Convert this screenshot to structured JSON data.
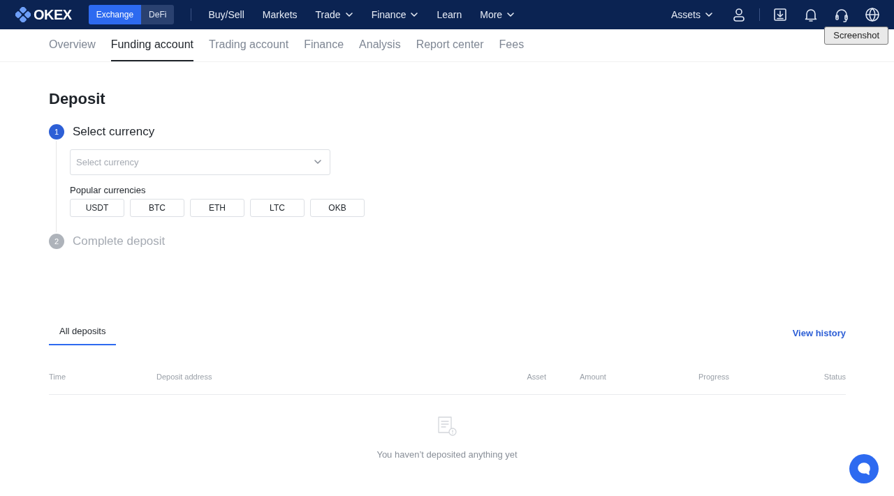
{
  "topbar": {
    "logo": "OKEX",
    "mode_switch": [
      {
        "label": "Exchange",
        "selected": true
      },
      {
        "label": "DeFi",
        "selected": false
      }
    ],
    "nav": [
      {
        "label": "Buy/Sell",
        "has_menu": false
      },
      {
        "label": "Markets",
        "has_menu": false
      },
      {
        "label": "Trade",
        "has_menu": true
      },
      {
        "label": "Finance",
        "has_menu": true
      },
      {
        "label": "Learn",
        "has_menu": false
      },
      {
        "label": "More",
        "has_menu": true
      }
    ],
    "assets": {
      "label": "Assets",
      "has_menu": true
    },
    "tooltip": "Screenshot"
  },
  "subnav": [
    {
      "label": "Overview",
      "selected": false
    },
    {
      "label": "Funding account",
      "selected": true
    },
    {
      "label": "Trading account",
      "selected": false
    },
    {
      "label": "Finance",
      "selected": false
    },
    {
      "label": "Analysis",
      "selected": false
    },
    {
      "label": "Report center",
      "selected": false
    },
    {
      "label": "Fees",
      "selected": false
    }
  ],
  "page_title": "Deposit",
  "steps": [
    {
      "number": "1",
      "title": "Select currency",
      "active": true
    },
    {
      "number": "2",
      "title": "Complete deposit",
      "active": false
    }
  ],
  "currency_select": {
    "placeholder": "Select currency"
  },
  "popular": {
    "label": "Popular currencies",
    "currencies": [
      "USDT",
      "BTC",
      "ETH",
      "LTC",
      "OKB"
    ]
  },
  "history": {
    "tabs": [
      {
        "label": "All deposits",
        "selected": true
      }
    ],
    "link": "View history",
    "columns": [
      "Time",
      "Deposit address",
      "Asset",
      "Amount",
      "Progress",
      "Status"
    ],
    "empty_message": "You haven’t deposited anything yet"
  }
}
